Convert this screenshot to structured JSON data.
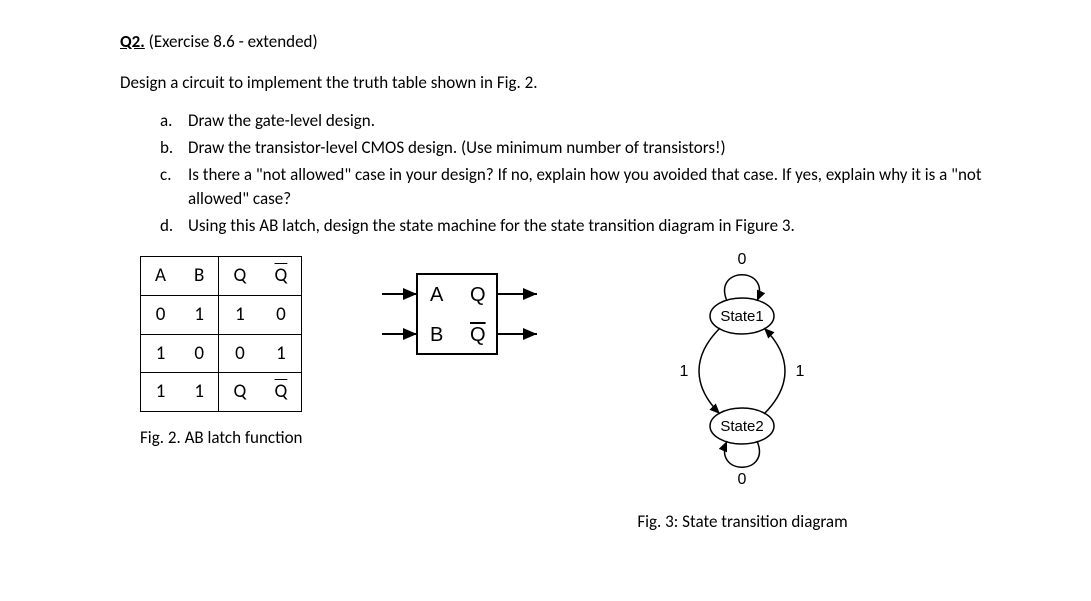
{
  "title": {
    "number": "Q2.",
    "rest": " (Exercise 8.6 - extended)"
  },
  "intro": "Design a circuit to implement the truth table shown in Fig. 2.",
  "list": {
    "a": {
      "marker": "a.",
      "text": "Draw the gate-level design."
    },
    "b": {
      "marker": "b.",
      "text": "Draw the transistor-level CMOS design. (Use minimum number of transistors!)"
    },
    "c": {
      "marker": "c.",
      "text": "Is there a \"not allowed\" case in your design? If no, explain how you avoided that case. If yes, explain why it is a \"not allowed\" case?"
    },
    "d": {
      "marker": "d.",
      "text": "Using this AB latch, design the state machine for the state transition diagram in Figure 3."
    }
  },
  "table": {
    "headers": {
      "A": "A",
      "B": "B",
      "Q": "Q",
      "Qbar": "Q"
    },
    "rows": [
      {
        "A": "0",
        "B": "1",
        "Q": "1",
        "Qbar": "0"
      },
      {
        "A": "1",
        "B": "0",
        "Q": "0",
        "Qbar": "1"
      },
      {
        "A": "1",
        "B": "1",
        "Q": "Q",
        "Qbar": "Q",
        "qbarOverline": true
      }
    ]
  },
  "block": {
    "A": "A",
    "B": "B",
    "Q": "Q",
    "Qbar": "Q"
  },
  "state": {
    "s1": "State1",
    "s2": "State2",
    "t0a": "0",
    "t1a": "1",
    "t1b": "1",
    "t0b": "0"
  },
  "captions": {
    "fig2": "Fig. 2. AB latch function",
    "fig3": "Fig. 3: State transition diagram"
  }
}
